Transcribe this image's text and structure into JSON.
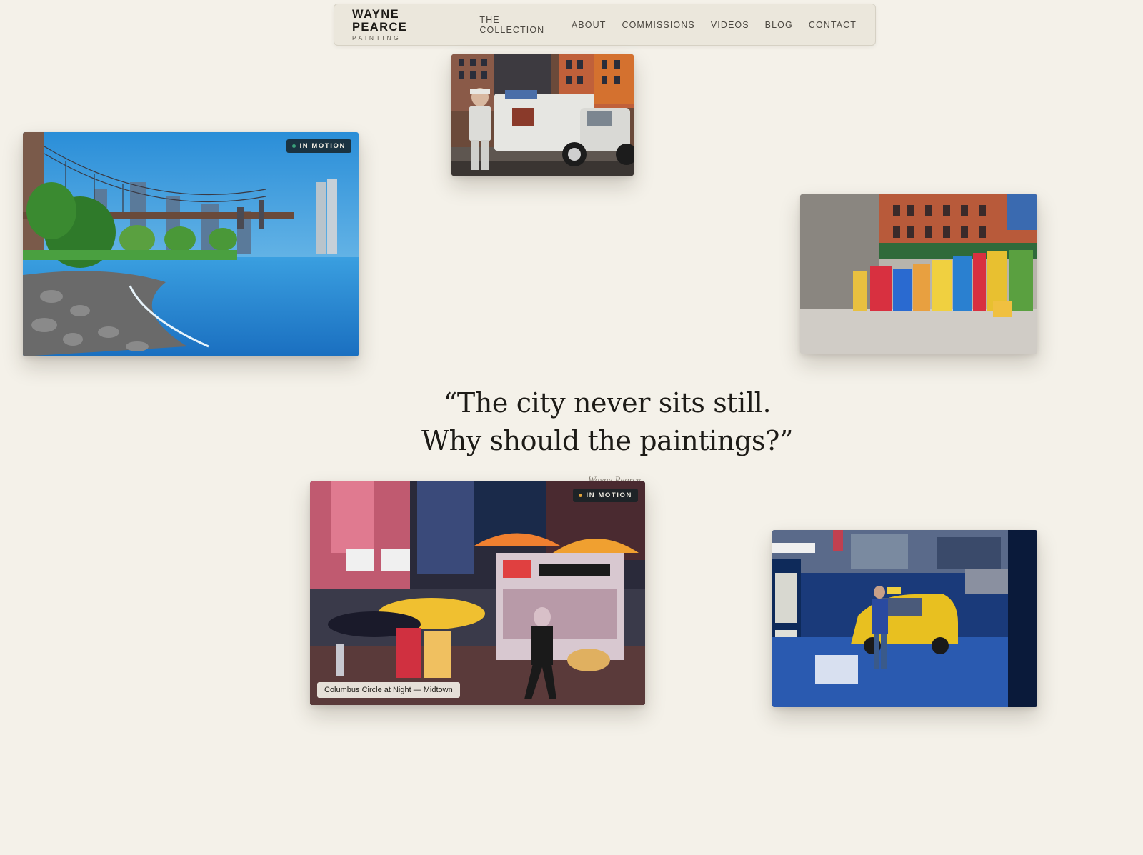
{
  "nav": {
    "brand_name": "WAYNE PEARCE",
    "brand_sub": "PAINTING",
    "links": [
      "THE COLLECTION",
      "ABOUT",
      "COMMISSIONS",
      "VIDEOS",
      "BLOG",
      "CONTACT"
    ]
  },
  "quote": {
    "line1": "“The city never sits still.",
    "line2": "Why should the paintings?”",
    "attribution": "Wayne Pearce"
  },
  "paintings": {
    "ice_cream_truck": {},
    "brooklyn_bridge": {
      "badge": "IN MOTION",
      "badge_dot_color": "#3aa07a"
    },
    "newspaper_boxes": {},
    "columbus_circle": {
      "badge": "IN MOTION",
      "badge_dot_color": "#e0a23a",
      "caption": "Columbus Circle at Night — Midtown"
    },
    "taxi_gas_station": {}
  },
  "colors": {
    "background": "#f4f1e9",
    "nav_bg": "#ebe7dc",
    "badge_bg": "#162226"
  }
}
